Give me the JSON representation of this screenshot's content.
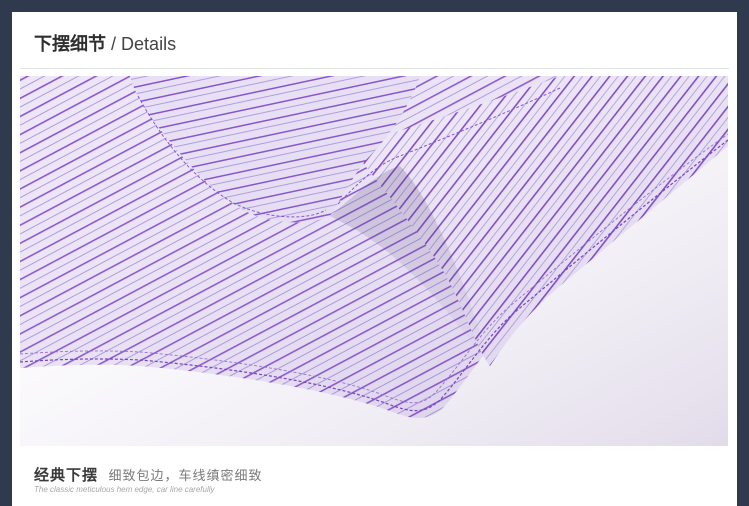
{
  "header": {
    "title_cn": "下摆细节",
    "separator": "/",
    "title_en": "Details"
  },
  "image": {
    "subject": "striped-shirt-hem-closeup",
    "colors": {
      "fabric": "#e9e1f6",
      "stripe": "#7a3fc2",
      "stripe_light": "#a987dc"
    }
  },
  "footer": {
    "title": "经典下摆",
    "subtitle": "细致包边，车线缜密细致",
    "caption_en": "The classic meticulous hem edge, car line carefully"
  }
}
